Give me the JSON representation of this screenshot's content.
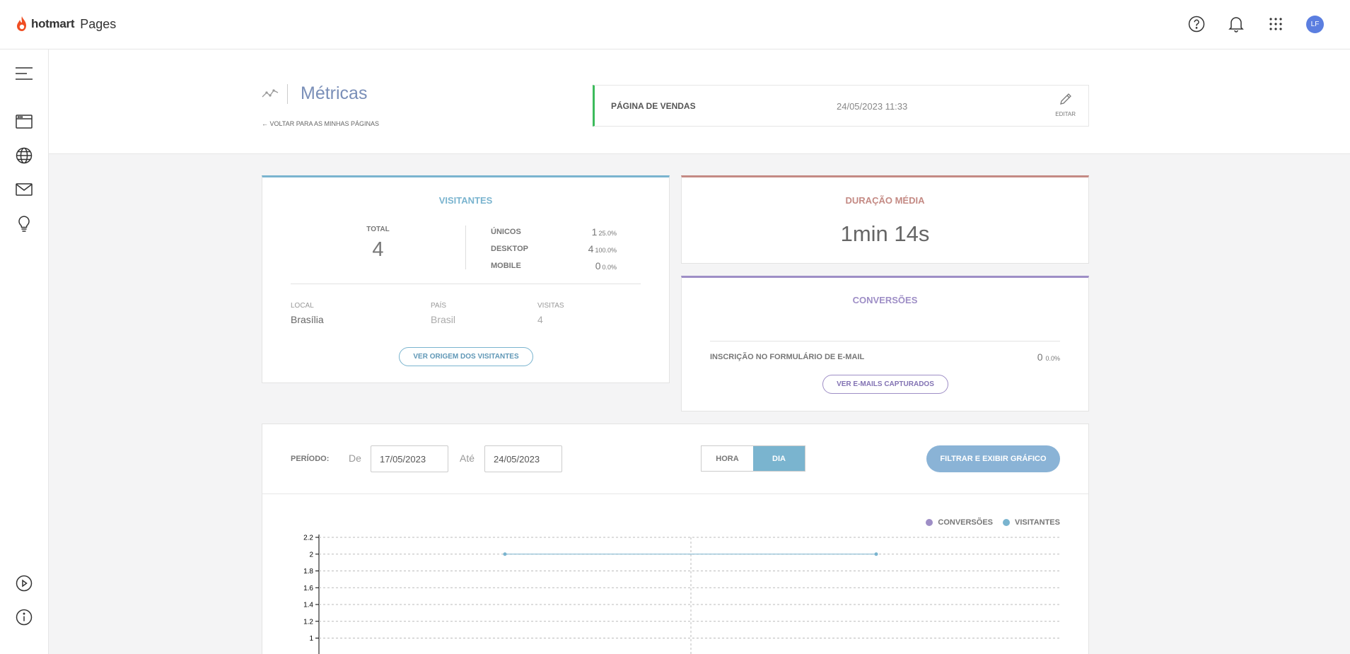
{
  "brand": {
    "name_bold": "hotmart",
    "name_light": "Pages"
  },
  "user": {
    "initials": "LF"
  },
  "page": {
    "title": "Métricas",
    "back_link": "VOLTAR PARA AS MINHAS PÁGINAS",
    "card_name": "PÁGINA DE VENDAS",
    "card_date": "24/05/2023 11:33",
    "edit_label": "EDITAR"
  },
  "visitors": {
    "title": "VISITANTES",
    "total_label": "TOTAL",
    "total_value": "4",
    "rows": [
      {
        "label": "ÚNICOS",
        "value": "1",
        "pct": "25.0%"
      },
      {
        "label": "DESKTOP",
        "value": "4",
        "pct": "100.0%"
      },
      {
        "label": "MOBILE",
        "value": "0",
        "pct": "0.0%"
      }
    ],
    "location": {
      "local_label": "LOCAL",
      "local_value": "Brasília",
      "pais_label": "PAÍS",
      "pais_value": "Brasil",
      "visitas_label": "VISITAS",
      "visitas_value": "4"
    },
    "origin_button": "VER ORIGEM DOS VISITANTES"
  },
  "duration": {
    "title": "DURAÇÃO MÉDIA",
    "value": "1min 14s"
  },
  "conversions": {
    "title": "CONVERSÕES",
    "row_label": "INSCRIÇÃO NO FORMULÁRIO DE E-MAIL",
    "row_value": "0",
    "row_pct": "0.0%",
    "button": "VER E-MAILS CAPTURADOS"
  },
  "filter": {
    "period_label": "PERÍODO:",
    "from_label": "De",
    "from_value": "17/05/2023",
    "to_label": "Até",
    "to_value": "24/05/2023",
    "hour_label": "HORA",
    "day_label": "DIA",
    "active": "DIA",
    "submit_label": "FILTRAR E EXIBIR GRÁFICO"
  },
  "colors": {
    "visitantes": "#7ab4cf",
    "conversoes": "#9e8ec6",
    "accent_green": "#3dbb5c"
  },
  "chart_data": {
    "type": "line",
    "legend": [
      "CONVERSÕES",
      "VISITANTES"
    ],
    "y_ticks": [
      "2.2",
      "2",
      "1.8",
      "1.6",
      "1.4",
      "1.2",
      "1"
    ],
    "ylim_visible": [
      1,
      2.2
    ],
    "grid": true,
    "legend_position": "top-right",
    "series": [
      {
        "name": "VISITANTES",
        "color": "#7ab4cf",
        "values": [
          2,
          2
        ]
      }
    ]
  }
}
